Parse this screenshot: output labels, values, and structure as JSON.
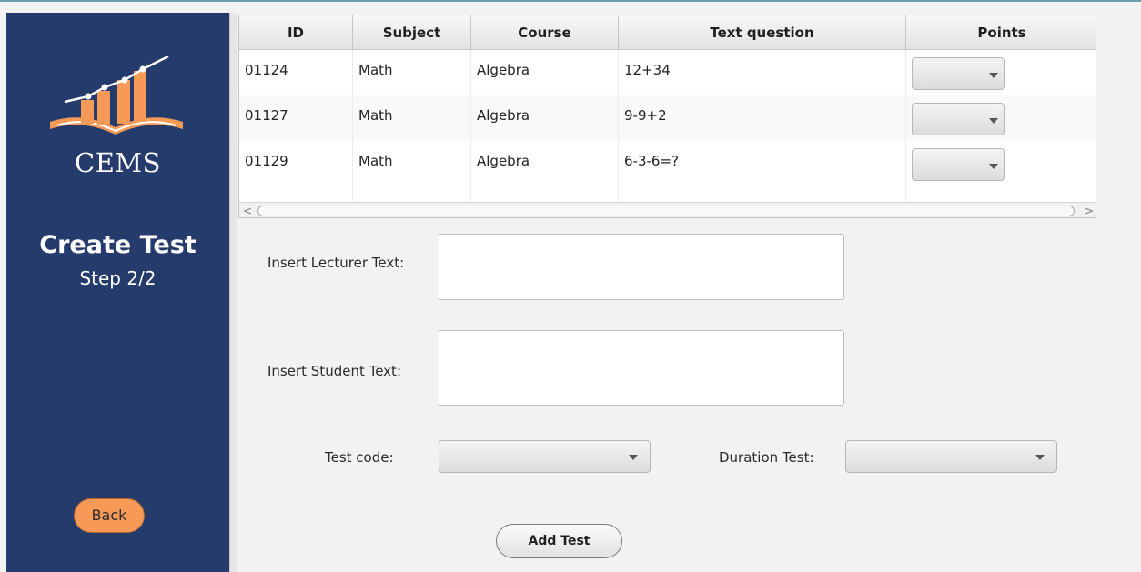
{
  "sidebar": {
    "logo_text": "CEMS",
    "title": "Create Test",
    "step": "Step 2/2",
    "back_label": "Back"
  },
  "table": {
    "columns": [
      "ID",
      "Subject",
      "Course",
      "Text question",
      "Points"
    ],
    "rows": [
      {
        "id": "01124",
        "subject": "Math",
        "course": "Algebra",
        "question": "12+34",
        "points": ""
      },
      {
        "id": "01127",
        "subject": "Math",
        "course": "Algebra",
        "question": "9-9+2",
        "points": ""
      },
      {
        "id": "01129",
        "subject": "Math",
        "course": "Algebra",
        "question": "6-3-6=?",
        "points": ""
      }
    ]
  },
  "form": {
    "lecturer_label": "Insert Lecturer Text:",
    "lecturer_value": "",
    "student_label": "Insert Student Text:",
    "student_value": "",
    "test_code_label": "Test code:",
    "duration_label": "Duration Test:"
  },
  "actions": {
    "add_test_label": "Add Test"
  },
  "colors": {
    "sidebar_bg": "#243b6b",
    "accent_orange": "#f79a57"
  }
}
